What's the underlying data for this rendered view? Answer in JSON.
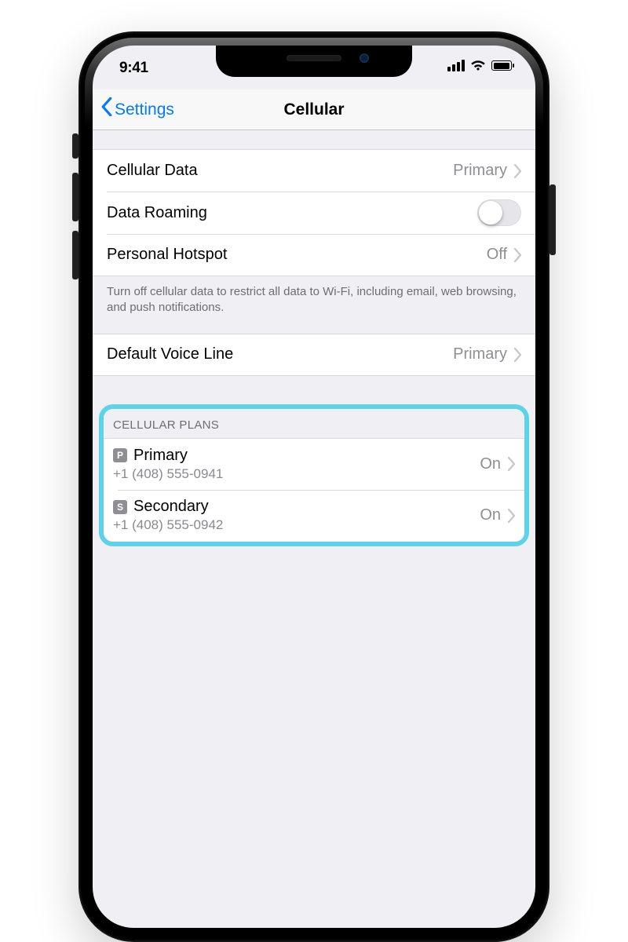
{
  "status_bar": {
    "time": "9:41"
  },
  "navbar": {
    "back_label": "Settings",
    "title": "Cellular"
  },
  "rows": {
    "cellular_data": {
      "label": "Cellular Data",
      "value": "Primary"
    },
    "data_roaming": {
      "label": "Data Roaming",
      "on": false
    },
    "personal_hotspot": {
      "label": "Personal Hotspot",
      "value": "Off"
    }
  },
  "footer_note": "Turn off cellular data to restrict all data to Wi-Fi, including email, web browsing, and push notifications.",
  "default_voice_line": {
    "label": "Default Voice Line",
    "value": "Primary"
  },
  "plans": {
    "header": "Cellular Plans",
    "items": [
      {
        "badge": "P",
        "name": "Primary",
        "number": "+1 (408) 555-0941",
        "status": "On"
      },
      {
        "badge": "S",
        "name": "Secondary",
        "number": "+1 (408) 555-0942",
        "status": "On"
      }
    ]
  },
  "colors": {
    "link": "#007aff",
    "highlight": "#5ed3e8",
    "secondary_text": "#8e8e93",
    "separator": "#d9d9d9",
    "group_bg": "#efeff4"
  }
}
